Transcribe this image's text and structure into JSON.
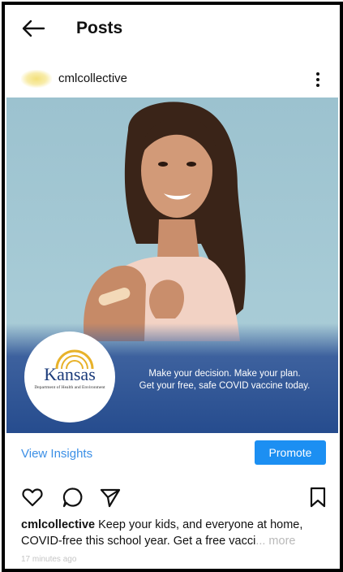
{
  "header": {
    "title": "Posts"
  },
  "post": {
    "author": "cmlcollective",
    "image": {
      "logo_name": "Kansas",
      "logo_subtitle": "Department of Health and Environment",
      "banner_line1": "Make your decision. Make your plan.",
      "banner_line2": "Get your free, safe COVID vaccine today."
    },
    "insights_label": "View Insights",
    "promote_label": "Promote",
    "caption_user": "cmlcollective",
    "caption_text": " Keep your kids, and everyone at home, COVID-free this school year. Get a free vacci",
    "caption_more": "... more",
    "timestamp": "17 minutes ago"
  },
  "icons": {
    "back": "back-arrow-icon",
    "more": "more-vertical-icon",
    "like": "heart-icon",
    "comment": "comment-icon",
    "share": "send-icon",
    "save": "bookmark-icon"
  },
  "colors": {
    "accent": "#1c8ff2",
    "link": "#3b8fe6",
    "banner_blue": "#264c8e"
  }
}
